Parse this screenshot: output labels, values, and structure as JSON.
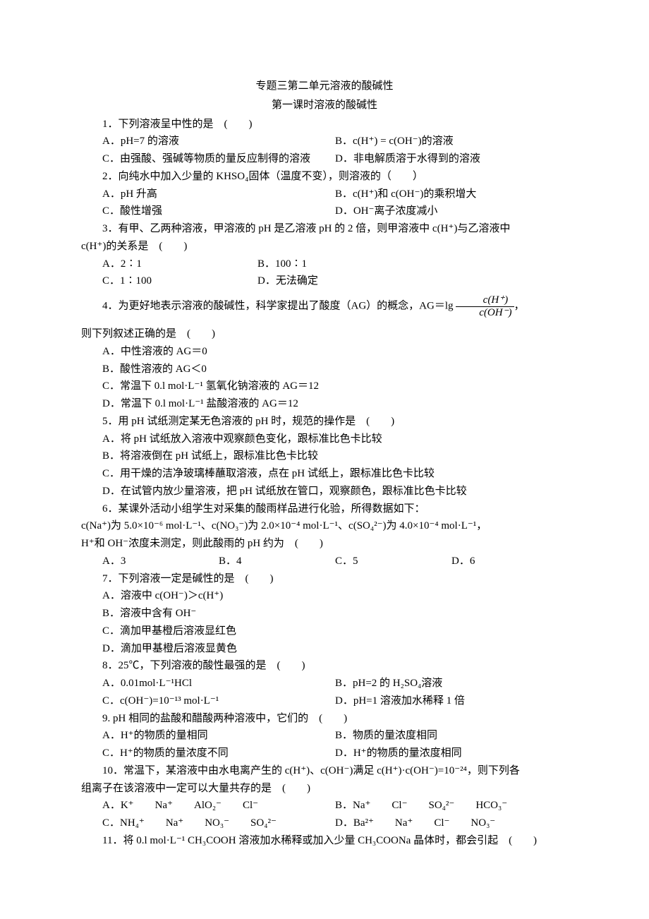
{
  "header": {
    "title1": "专题三第二单元溶液的酸碱性",
    "title2": "第一课时溶液的酸碱性"
  },
  "q1": {
    "stem": "1．下列溶液呈中性的是　(　　)",
    "a": "A．pH=7 的溶液",
    "b": "B．c(H⁺) = c(OH⁻)的溶液",
    "c": "C．由强酸、强碱等物质的量反应制得的溶液",
    "d": "D．非电解质溶于水得到的溶液"
  },
  "q2": {
    "stem": "2．向纯水中加入少量的 KHSO₄固体（温度不变），则溶液的（　　）",
    "a": "A．pH 升高",
    "b": "B．c(H⁺)和 c(OH⁻)的乘积增大",
    "c": "C．酸性增强",
    "d": "D．OH⁻离子浓度减小"
  },
  "q3": {
    "stem1": "3．有甲、乙两种溶液，甲溶液的 pH 是乙溶液 pH 的 2 倍，则甲溶液中 c(H⁺)与乙溶液中",
    "stem2": "c(H⁺)的关系是　(　　)",
    "a": "A．2∶1",
    "b": "B．100∶1",
    "c": "C．1∶100",
    "d": "D．无法确定"
  },
  "q4": {
    "stem_pre": "4．为更好地表示溶液的酸碱性，科学家提出了酸度（AG）的概念，AG＝lg",
    "stem_post": "，",
    "frac_num": "c(H⁺)",
    "frac_den": "c(OH⁻)",
    "stem2": "则下列叙述正确的是　(　　)",
    "a": "A．中性溶液的 AG＝0",
    "b": "B．酸性溶液的 AG＜0",
    "c": "C．常温下 0.l mol·L⁻¹ 氢氧化钠溶液的 AG＝12",
    "d": "D．常温下 0.l mol·L⁻¹ 盐酸溶液的 AG＝12"
  },
  "q5": {
    "stem": "5．用 pH 试纸测定某无色溶液的 pH 时，规范的操作是　(　　)",
    "a": "A．将 pH 试纸放入溶液中观察颜色变化，跟标准比色卡比较",
    "b": "B．将溶液倒在 pH 试纸上，跟标准比色卡比较",
    "c": "C．用干燥的洁净玻璃棒蘸取溶液，点在 pH 试纸上，跟标准比色卡比较",
    "d": "D．在试管内放少量溶液，把 pH 试纸放在管口，观察颜色，跟标准比色卡比较"
  },
  "q6": {
    "stem1": "6．某课外活动小组学生对采集的酸雨样品进行化验，所得数据如下：",
    "stem2": "c(Na⁺)为 5.0×10⁻⁶ mol·L⁻¹、c(NO₃⁻)为 2.0×10⁻⁴ mol·L⁻¹、c(SO₄²⁻)为 4.0×10⁻⁴ mol·L⁻¹，",
    "stem3": "H⁺和 OH⁻浓度未测定，则此酸雨的 pH 约为　(　　)",
    "a": "A．3",
    "b": "B．4",
    "c": "C．5",
    "d": "D．6"
  },
  "q7": {
    "stem": "7．下列溶液一定是碱性的是　(　　)",
    "a": "A．溶液中 c(OH⁻)＞c(H⁺)",
    "b": "B．溶液中含有 OH⁻",
    "c": "C．滴加甲基橙后溶液显红色",
    "d": "D．滴加甲基橙后溶液显黄色"
  },
  "q8": {
    "stem": "8．25℃，下列溶液的酸性最强的是　(　　)",
    "a": "A．0.01mol·L⁻¹HCl",
    "b": "B．pH=2 的 H₂SO₄溶液",
    "c": "C．c(OH⁻)=10⁻¹³ mol·L⁻¹",
    "d": "D．pH=1 溶液加水稀释 1 倍"
  },
  "q9": {
    "stem": "9. pH 相同的盐酸和醋酸两种溶液中，它们的　(　　)",
    "a": "A．H⁺的物质的量相同",
    "b": "B．物质的量浓度相同",
    "c": "C．H⁺的物质的量浓度不同",
    "d": "D．H⁺的物质的量浓度相同"
  },
  "q10": {
    "stem1": "10．常温下，某溶液中由水电离产生的 c(H⁺)、c(OH⁻)满足 c(H⁺)·c(OH⁻)=10⁻²⁴，则下列各",
    "stem2": "组离子在该溶液中一定可以大量共存的是　(　　)",
    "a": "A．K⁺　　Na⁺　　AlO₂⁻　　Cl⁻",
    "b": "B．Na⁺　　Cl⁻　　SO₄²⁻　　HCO₃⁻",
    "c": "C．NH₄⁺　　Na⁺　　NO₃⁻　　SO₄²⁻",
    "d": "D．Ba²⁺　　Na⁺　　Cl⁻　　NO₃⁻"
  },
  "q11": {
    "stem": "11．将 0.l mol·L⁻¹ CH₃COOH 溶液加水稀释或加入少量 CH₃COONa 晶体时，都会引起　(　　)"
  }
}
